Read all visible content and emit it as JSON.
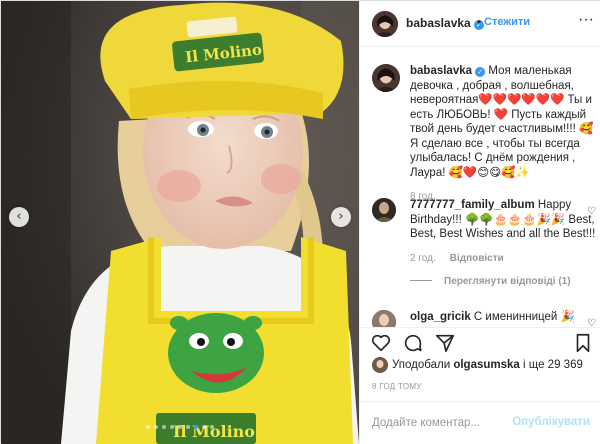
{
  "post": {
    "author": "babaslavka",
    "follow_label": "Стежити",
    "header_separator": "•",
    "more_icon": "ellipsis-icon",
    "verified_icon": "verified-badge-icon"
  },
  "photo": {
    "hat_brand": "Il Molino",
    "apron_brand": "Il Molino",
    "slide_count": 9,
    "active_slide": 6,
    "prev_icon": "chevron-left-icon",
    "next_icon": "chevron-right-icon"
  },
  "caption": {
    "username": "babaslavka",
    "text": " Моя маленькая девочка , добрая , волшебная, невероятная❤️❤️❤️❤️❤️❤️ Ты и есть ЛЮБОВЬ! ❤️ Пусть каждый твой день будет счастливым!!!! 🥰 Я сделаю все , чтобы ты всегда улыбалась! С днём рождения , Лаура! 🥰❤️😊😋🥰✨",
    "time": "8 год."
  },
  "comments": [
    {
      "username": "7777777_family_album",
      "text": " Happy Birthday!!! 🌳🌳🎂🎂🎂🎉🎉 Best, Best, Best Wishes and all the Best!!!",
      "time": "2 год.",
      "reply_label": "Відповісти",
      "view_replies": "Переглянути відповіді (1)"
    },
    {
      "username": "olga_gricik",
      "text": " С именинницей 🎉"
    }
  ],
  "actions": {
    "like_icon": "heart-icon",
    "comment_icon": "comment-icon",
    "share_icon": "paper-plane-icon",
    "save_icon": "bookmark-icon"
  },
  "likes": {
    "prefix": "Уподобали ",
    "user": "olgasumska",
    "suffix": " і ще 29 369"
  },
  "timestamp": "8 ГОД ТОМУ",
  "add_comment": {
    "placeholder": "Додайте коментар...",
    "publish_label": "Опублікувати"
  }
}
